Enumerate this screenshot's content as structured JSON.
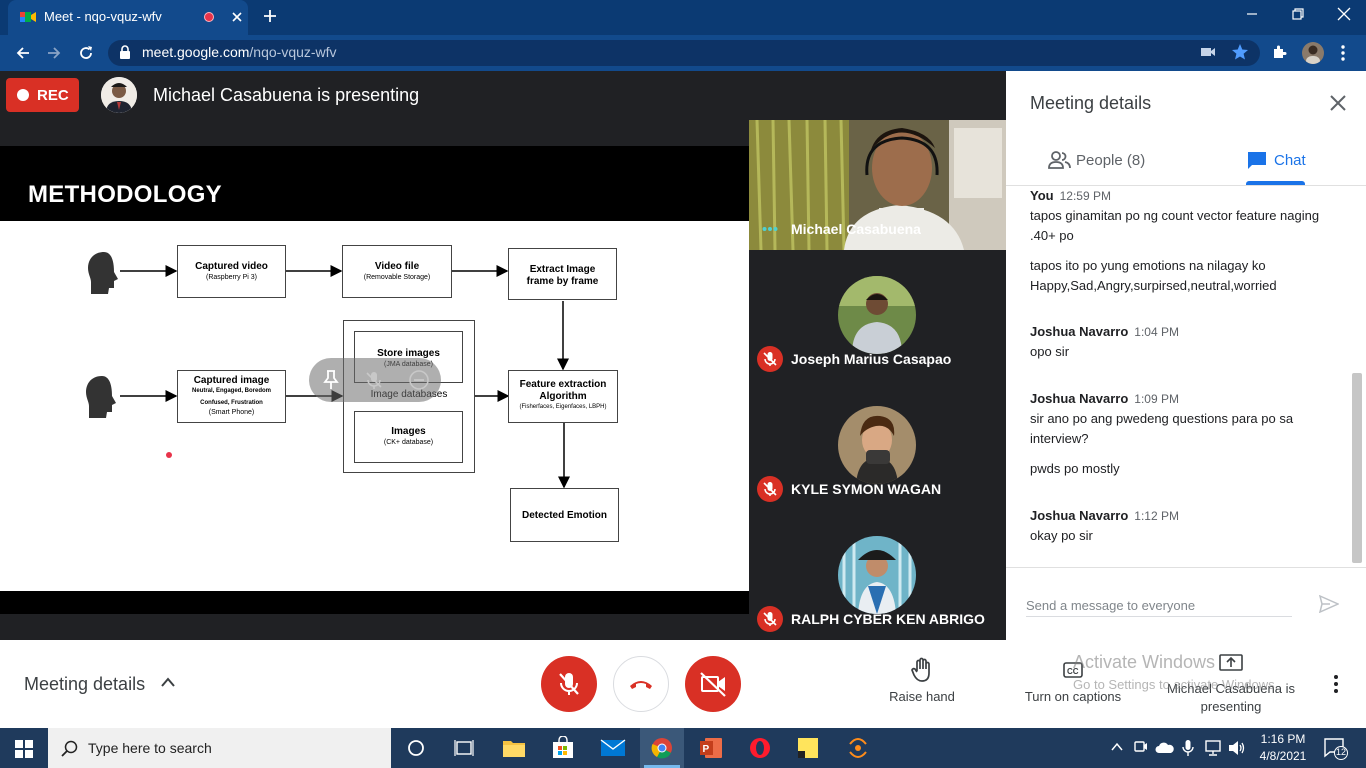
{
  "browser": {
    "tab_title": "Meet - nqo-vquz-wfv",
    "url_host": "meet.google.com",
    "url_path": "/nqo-vquz-wfv"
  },
  "meeting": {
    "rec_label": "REC",
    "presenting_text": "Michael Casabuena is presenting"
  },
  "slide": {
    "title": "METHODOLOGY",
    "boxes": {
      "captured_video": {
        "main": "Captured video",
        "sub": "(Raspberry Pi 3)"
      },
      "video_file": {
        "main": "Video file",
        "sub": "(Removable Storage)"
      },
      "extract_image": {
        "main": "Extract Image frame by frame"
      },
      "captured_image": {
        "main": "Captured image",
        "sub1": "Neutral, Engaged, Boredom",
        "sub2": "Confused, Frustration",
        "sub3": "(Smart Phone)"
      },
      "store_images": {
        "main": "Store images",
        "sub": "(JMA database)"
      },
      "image_databases": {
        "main": "Image databases"
      },
      "images": {
        "main": "Images",
        "sub": "(CK+ database)"
      },
      "feature_extraction": {
        "main": "Feature extraction Algorithm",
        "sub": "(Fisherfaces, Eigenfaces, LBPH)"
      },
      "detected_emotion": {
        "main": "Detected Emotion"
      }
    }
  },
  "participants": [
    {
      "name": "Michael Casabuena"
    },
    {
      "name": "Joseph Marius Casapao"
    },
    {
      "name": "KYLE SYMON WAGAN"
    },
    {
      "name": "RALPH CYBER KEN ABRIGO"
    }
  ],
  "panel": {
    "title": "Meeting details",
    "people_tab": "People (8)",
    "chat_tab": "Chat",
    "messages": [
      {
        "sender": "You",
        "time": "12:59 PM",
        "lines": [
          "tapos ginamitan po ng count vector feature naging .40+ po",
          "tapos ito po yung emotions na nilagay ko Happy,Sad,Angry,surpirsed,neutral,worried"
        ]
      },
      {
        "sender": "Joshua Navarro",
        "time": "1:04 PM",
        "lines": [
          "opo sir"
        ]
      },
      {
        "sender": "Joshua Navarro",
        "time": "1:09 PM",
        "lines": [
          "sir ano po ang pwedeng questions para po sa interview?",
          "pwds po mostly"
        ]
      },
      {
        "sender": "Joshua Navarro",
        "time": "1:12 PM",
        "lines": [
          "okay po sir"
        ]
      }
    ],
    "input_placeholder": "Send a message to everyone"
  },
  "bottom": {
    "details_label": "Meeting details",
    "raise_hand": "Raise hand",
    "captions": "Turn on captions",
    "presenting": "Michael Casabuena is presenting"
  },
  "watermark": {
    "line1": "Activate Windows",
    "line2": "Go to Settings to activate Windows."
  },
  "taskbar": {
    "search_placeholder": "Type here to search",
    "time": "1:16 PM",
    "date": "4/8/2021",
    "notification_count": "12"
  },
  "colors": {
    "meet_red": "#d93025",
    "meet_blue": "#1a73e8",
    "chrome_dark": "#0b3a73"
  }
}
